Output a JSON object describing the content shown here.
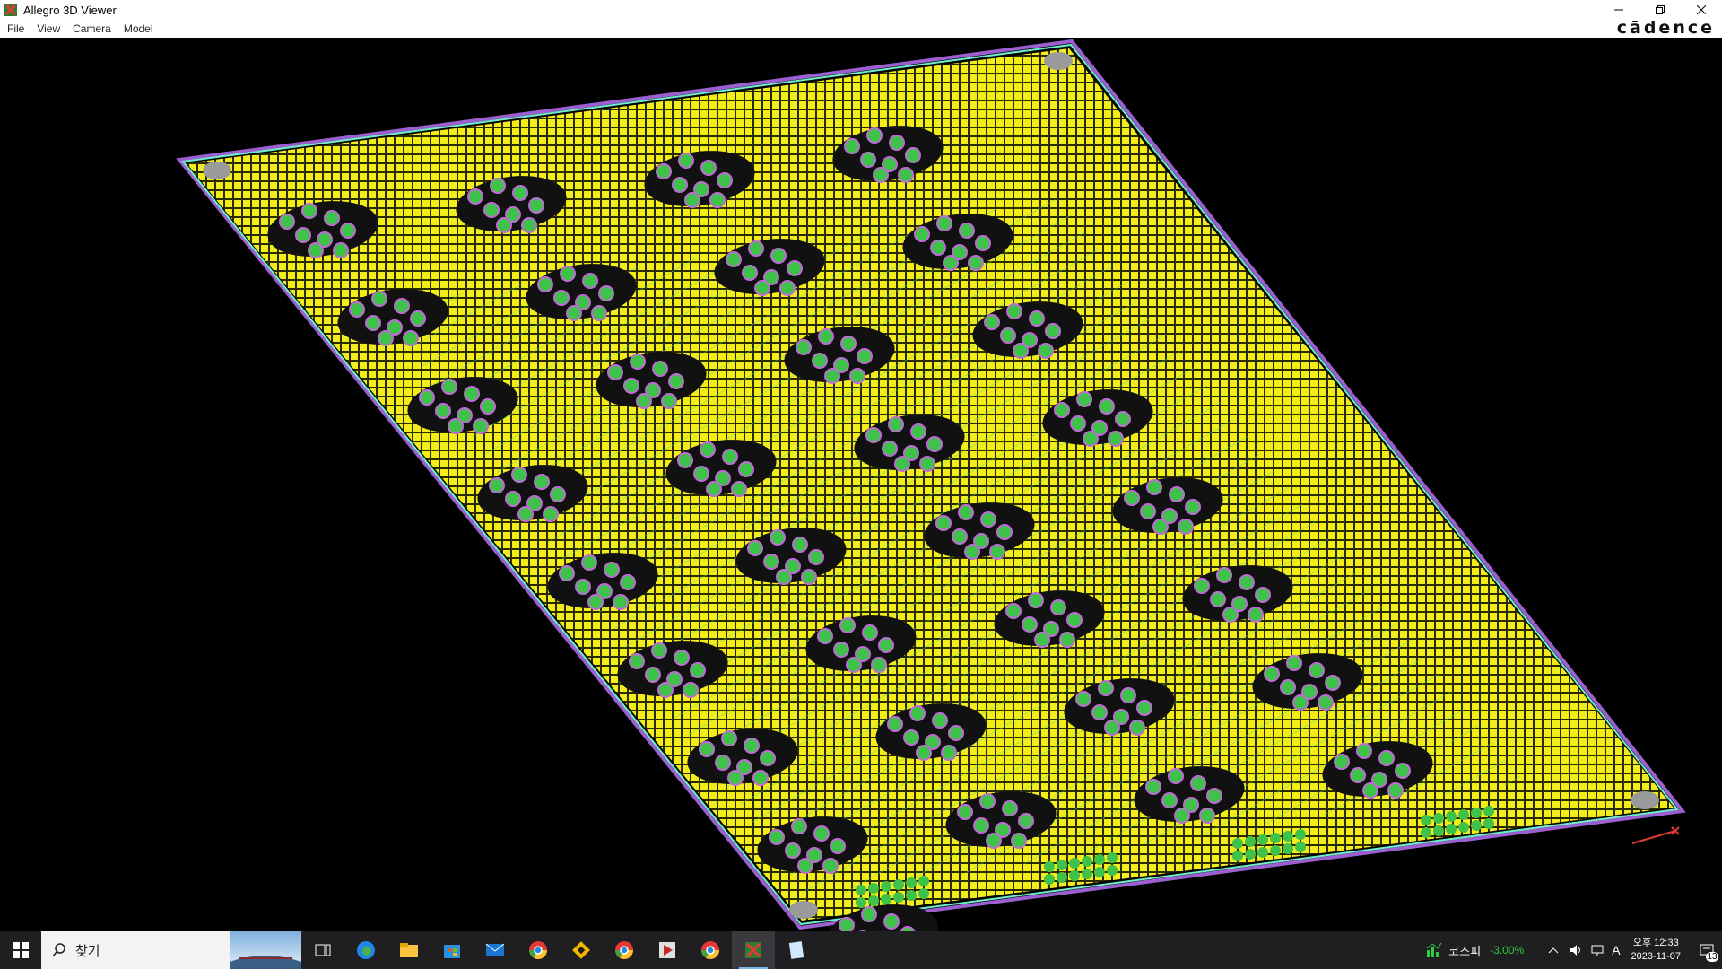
{
  "window": {
    "title": "Allegro 3D Viewer",
    "brand": "cādence",
    "controls": [
      "minimize-icon",
      "restore-icon",
      "close-icon"
    ]
  },
  "menu": {
    "items": [
      {
        "label": "File"
      },
      {
        "label": "View"
      },
      {
        "label": "Camera"
      },
      {
        "label": "Model"
      }
    ]
  },
  "viewport": {
    "description_colors": {
      "board_fill": "#e8e34a",
      "pad_yellow": "#f0f000",
      "via_green": "#3fc24a",
      "trace_cyan": "#6cf0c8",
      "edge_purple": "#9b5fd0",
      "background": "#000000"
    },
    "board_dims": {
      "cols": 4,
      "rows": 9
    }
  },
  "taskbar": {
    "search_placeholder": "찾기",
    "apps": [
      "task-view-icon",
      "edge-icon",
      "file-explorer-icon",
      "store-icon",
      "mail-icon",
      "chrome-icon",
      "git-icon",
      "chrome-alt-icon",
      "media-icon",
      "chrome-profile-icon",
      "allegro-icon",
      "notepad-icon"
    ],
    "stock_name": "코스피",
    "stock_change": "-3.00%",
    "clock_time": "오후 12:33",
    "clock_date": "2023-11-07",
    "notification_count": "13"
  }
}
